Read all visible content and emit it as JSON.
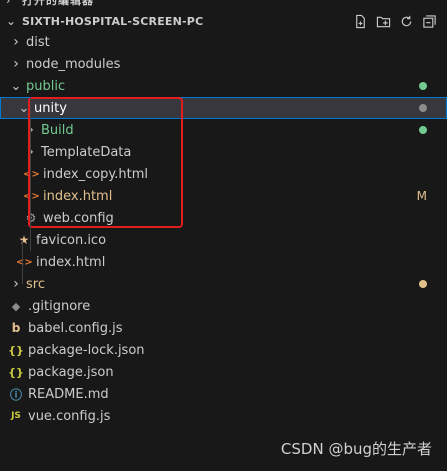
{
  "cut_header": "打开的编辑器",
  "explorer": {
    "title": "SIXTH-HOSPITAL-SCREEN-PC",
    "actions": [
      "new-file-icon",
      "new-folder-icon",
      "refresh-icon",
      "collapse-icon"
    ]
  },
  "tree": [
    {
      "label": "dist",
      "type": "folder",
      "depth": 0,
      "expanded": false,
      "color": "#cccccc"
    },
    {
      "label": "node_modules",
      "type": "folder",
      "depth": 0,
      "expanded": false,
      "color": "#cccccc"
    },
    {
      "label": "public",
      "type": "folder",
      "depth": 0,
      "expanded": true,
      "color": "#73c991",
      "status": "dot-green"
    },
    {
      "label": "unity",
      "type": "folder",
      "depth": 1,
      "expanded": true,
      "color": "#ffffff",
      "status": "dot-gray",
      "selected": true
    },
    {
      "label": "Build",
      "type": "folder",
      "depth": 2,
      "expanded": false,
      "color": "#73c991",
      "status": "dot-green"
    },
    {
      "label": "TemplateData",
      "type": "folder",
      "depth": 2,
      "expanded": false,
      "color": "#cccccc"
    },
    {
      "label": "index_copy.html",
      "type": "html",
      "depth": 2,
      "color": "#cccccc"
    },
    {
      "label": "index.html",
      "type": "html",
      "depth": 2,
      "color": "#e2c08d",
      "status": "M"
    },
    {
      "label": "web.config",
      "type": "config",
      "depth": 2,
      "color": "#cccccc"
    },
    {
      "label": "favicon.ico",
      "type": "star",
      "depth": 1,
      "color": "#cccccc"
    },
    {
      "label": "index.html",
      "type": "html",
      "depth": 1,
      "color": "#cccccc"
    },
    {
      "label": "src",
      "type": "folder",
      "depth": 0,
      "expanded": false,
      "color": "#e2c08d",
      "status": "dot-yellow"
    },
    {
      "label": ".gitignore",
      "type": "git",
      "depth": 0,
      "color": "#cccccc"
    },
    {
      "label": "babel.config.js",
      "type": "babel",
      "depth": 0,
      "color": "#cccccc"
    },
    {
      "label": "package-lock.json",
      "type": "json",
      "depth": 0,
      "color": "#cccccc"
    },
    {
      "label": "package.json",
      "type": "json",
      "depth": 0,
      "color": "#cccccc"
    },
    {
      "label": "README.md",
      "type": "info",
      "depth": 0,
      "color": "#cccccc"
    },
    {
      "label": "vue.config.js",
      "type": "js",
      "depth": 0,
      "color": "#cccccc"
    }
  ],
  "colors": {
    "dot-green": "#73c991",
    "dot-gray": "#8c8c8c",
    "dot-yellow": "#e2c08d",
    "badge-M": "#e2c08d",
    "annotation": "#e01e1e"
  },
  "watermark": "CSDN @bug的生产者"
}
